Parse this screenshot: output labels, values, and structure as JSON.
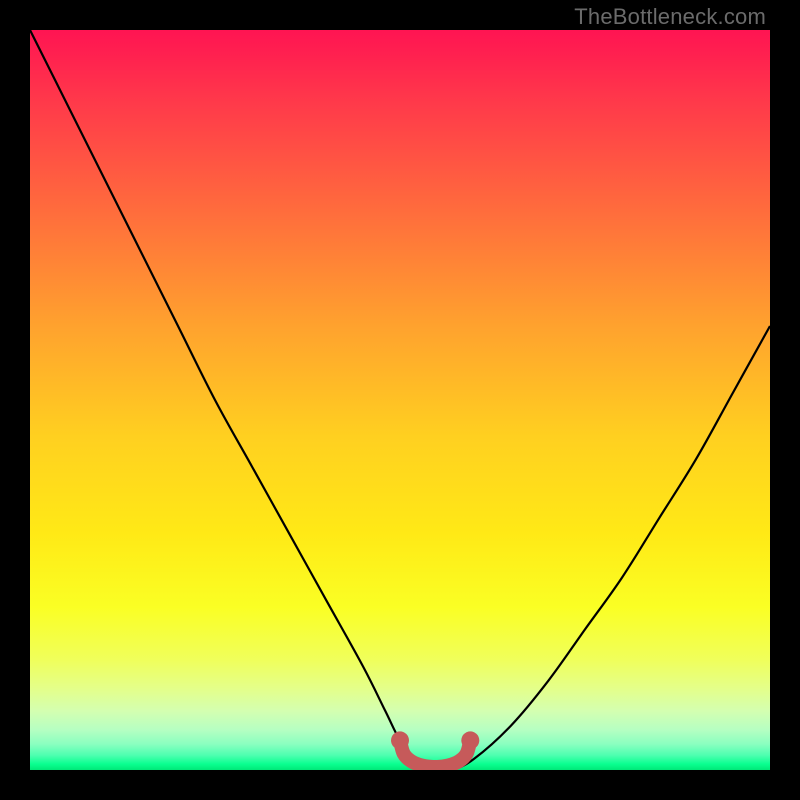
{
  "watermark": "TheBottleneck.com",
  "chart_data": {
    "type": "line",
    "title": "",
    "xlabel": "",
    "ylabel": "",
    "xlim": [
      0,
      100
    ],
    "ylim": [
      0,
      100
    ],
    "grid": false,
    "legend": false,
    "background": {
      "description": "vertical rainbow gradient red → orange → yellow → green (bottleneck heatmap)",
      "stops": [
        {
          "pct": 0,
          "color": "#ff1452"
        },
        {
          "pct": 25,
          "color": "#ff6e3c"
        },
        {
          "pct": 55,
          "color": "#ffd020"
        },
        {
          "pct": 78,
          "color": "#faff24"
        },
        {
          "pct": 94,
          "color": "#b7ffc2"
        },
        {
          "pct": 100,
          "color": "#00e878"
        }
      ]
    },
    "series": [
      {
        "name": "bottleneck-curve",
        "x": [
          0,
          5,
          10,
          15,
          20,
          25,
          30,
          35,
          40,
          45,
          48,
          50,
          52,
          55,
          57,
          60,
          65,
          70,
          75,
          80,
          85,
          90,
          95,
          100
        ],
        "y": [
          100,
          90,
          80,
          70,
          60,
          50,
          41,
          32,
          23,
          14,
          8,
          4,
          1.5,
          0,
          0,
          1.5,
          6,
          12,
          19,
          26,
          34,
          42,
          51,
          60
        ],
        "color": "#000000",
        "width": 2
      },
      {
        "name": "optimal-marker",
        "x": [
          50,
          50.5,
          51.5,
          53,
          55,
          56.5,
          58,
          59,
          59.5
        ],
        "y": [
          4,
          2.2,
          1.2,
          0.6,
          0.4,
          0.6,
          1.2,
          2.2,
          4
        ],
        "color": "#c65a5a",
        "width": 6,
        "endpoints": true
      }
    ],
    "annotations": [
      {
        "text": "TheBottleneck.com",
        "position": "top-right",
        "role": "watermark"
      }
    ]
  }
}
